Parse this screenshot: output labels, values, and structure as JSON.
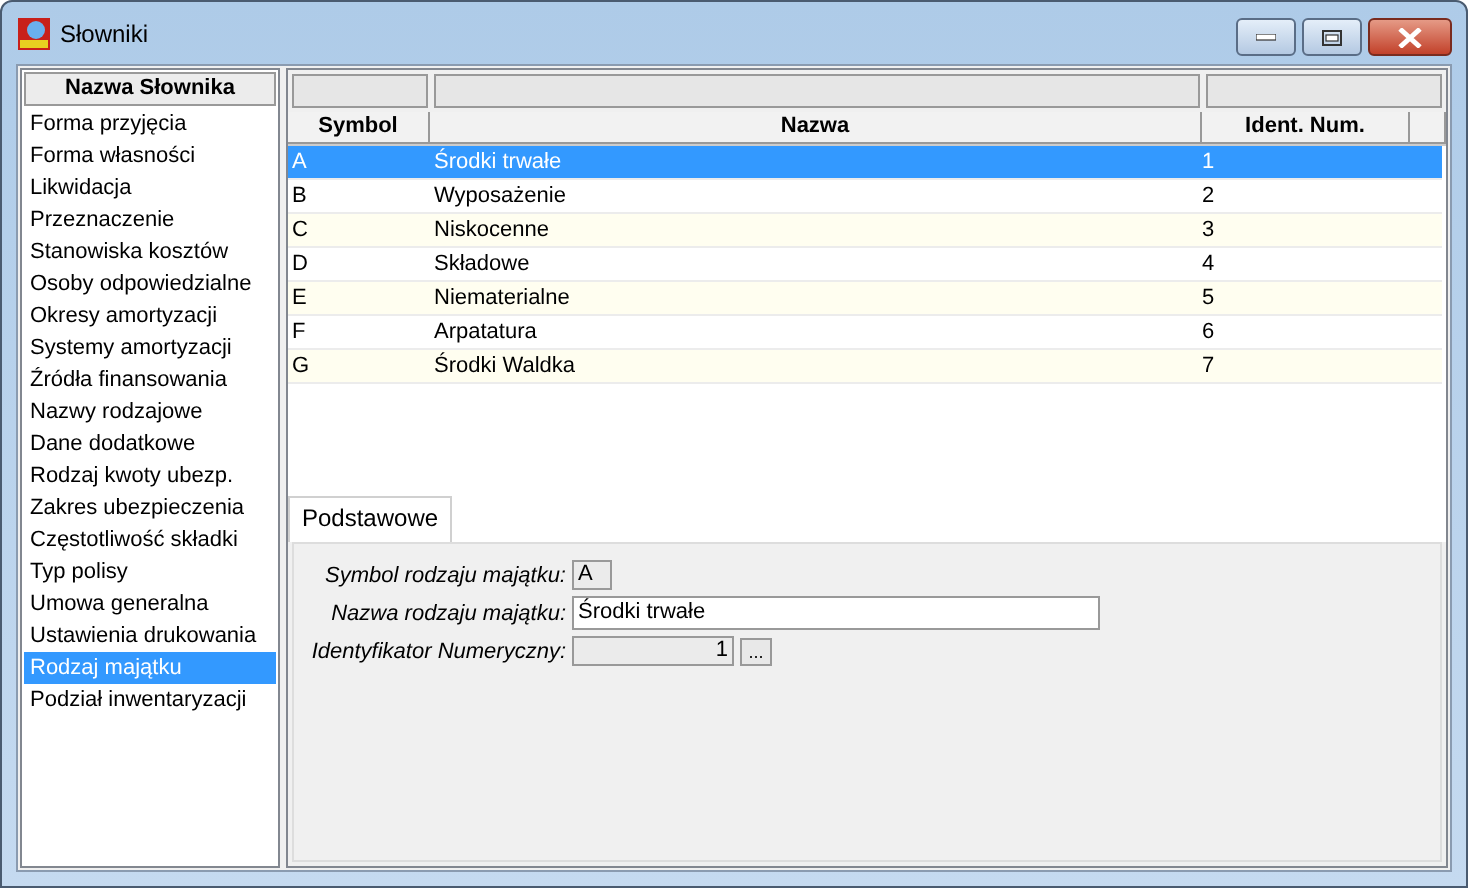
{
  "window": {
    "title": "Słowniki"
  },
  "dictionary_list": {
    "header": "Nazwa Słownika",
    "items": [
      {
        "label": "Forma przyjęcia",
        "selected": false
      },
      {
        "label": "Forma własności",
        "selected": false
      },
      {
        "label": "Likwidacja",
        "selected": false
      },
      {
        "label": "Przeznaczenie",
        "selected": false
      },
      {
        "label": "Stanowiska kosztów",
        "selected": false
      },
      {
        "label": "Osoby odpowiedzialne",
        "selected": false
      },
      {
        "label": "Okresy amortyzacji",
        "selected": false
      },
      {
        "label": "Systemy amortyzacji",
        "selected": false
      },
      {
        "label": "Źródła finansowania",
        "selected": false
      },
      {
        "label": "Nazwy rodzajowe",
        "selected": false
      },
      {
        "label": "Dane dodatkowe",
        "selected": false
      },
      {
        "label": "Rodzaj kwoty ubezp.",
        "selected": false
      },
      {
        "label": "Zakres ubezpieczenia",
        "selected": false
      },
      {
        "label": "Częstotliwość składki",
        "selected": false
      },
      {
        "label": "Typ polisy",
        "selected": false
      },
      {
        "label": "Umowa generalna",
        "selected": false
      },
      {
        "label": "Ustawienia drukowania",
        "selected": false
      },
      {
        "label": "Rodzaj majątku",
        "selected": true
      },
      {
        "label": "Podział inwentaryzacji",
        "selected": false
      }
    ]
  },
  "table": {
    "columns": [
      "Symbol",
      "Nazwa",
      "Ident. Num."
    ],
    "rows": [
      {
        "cells": [
          "A",
          "Środki trwałe",
          "1"
        ],
        "selected": true
      },
      {
        "cells": [
          "B",
          "Wyposażenie",
          "2"
        ],
        "selected": false
      },
      {
        "cells": [
          "C",
          "Niskocenne",
          "3"
        ],
        "selected": false
      },
      {
        "cells": [
          "D",
          "Składowe",
          "4"
        ],
        "selected": false
      },
      {
        "cells": [
          "E",
          "Niematerialne",
          "5"
        ],
        "selected": false
      },
      {
        "cells": [
          "F",
          "Arpatatura",
          "6"
        ],
        "selected": false
      },
      {
        "cells": [
          "G",
          "Środki Waldka",
          "7"
        ],
        "selected": false
      }
    ]
  },
  "tabs": [
    {
      "label": "Podstawowe",
      "selected": true
    }
  ],
  "form": {
    "fields": [
      {
        "label": "Symbol rodzaju majątku:",
        "value": "A",
        "disabled": true
      },
      {
        "label": "Nazwa rodzaju majątku:",
        "value": "Środki trwałe",
        "disabled": false
      },
      {
        "label": "Identyfikator Numeryczny:",
        "value": "1",
        "disabled": true,
        "button": "..."
      }
    ]
  }
}
